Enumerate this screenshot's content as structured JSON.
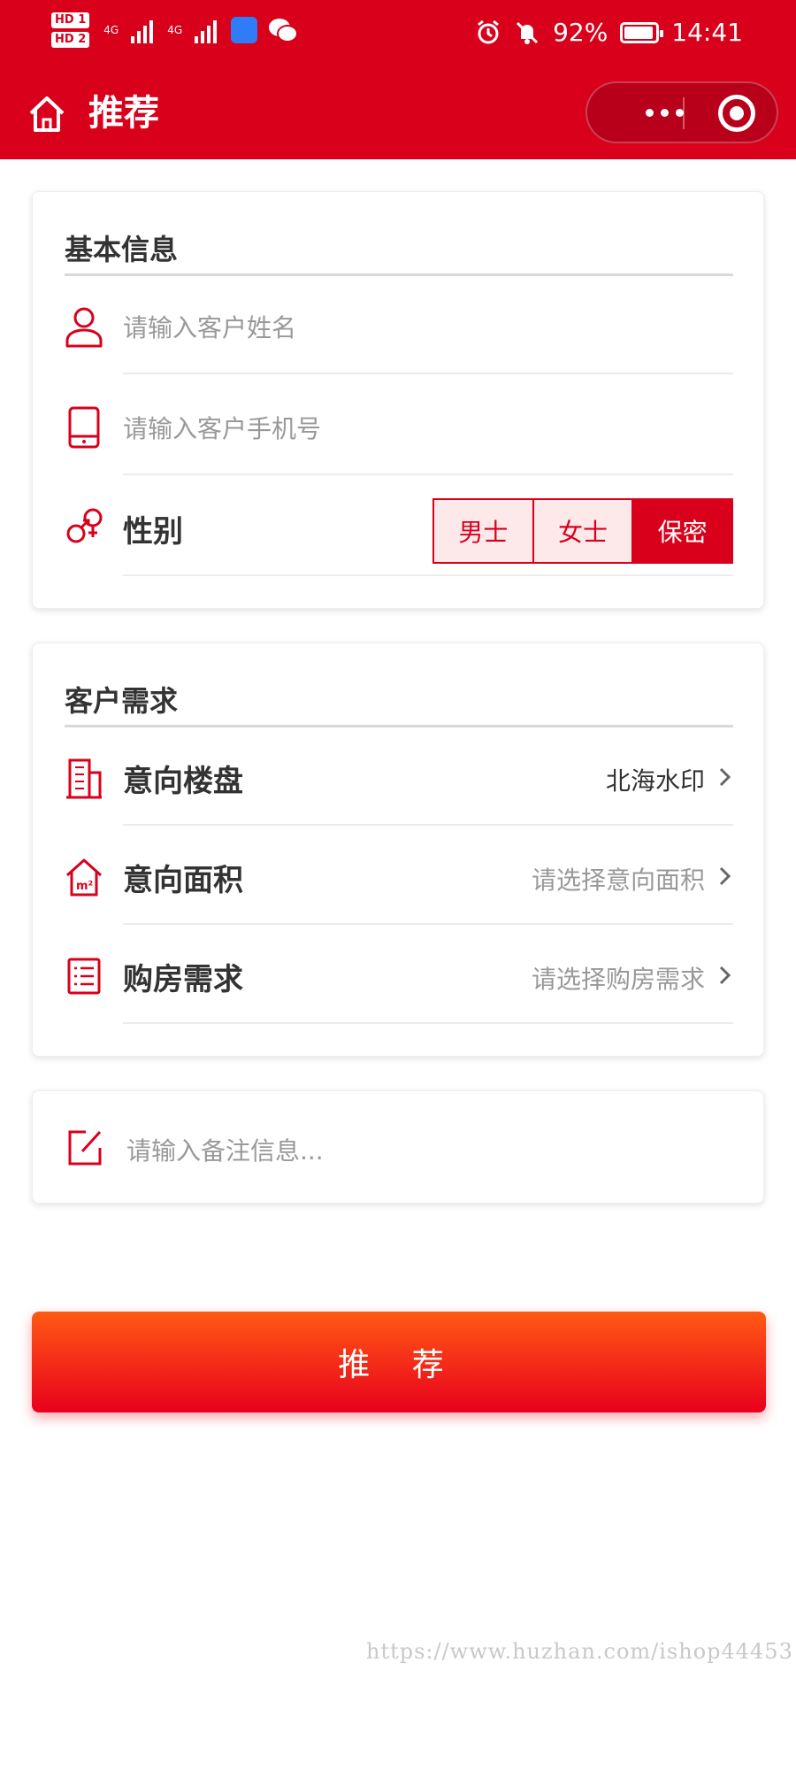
{
  "status_bar": {
    "hd1": "HD 1",
    "hd2": "HD 2",
    "net1": "4G",
    "net2": "4G",
    "battery": "92%",
    "time": "14:41",
    "icons": [
      "alarm-icon",
      "bell-mute-icon",
      "battery-icon",
      "wechat-icon",
      "app-icon"
    ]
  },
  "header": {
    "title": "推荐",
    "home_icon": "home-icon",
    "more_icon": "more-dots-icon",
    "close_icon": "target-circle-icon"
  },
  "basic_info": {
    "title": "基本信息",
    "name_placeholder": "请输入客户姓名",
    "phone_placeholder": "请输入客户手机号",
    "gender_label": "性别",
    "gender_options": [
      "男士",
      "女士",
      "保密"
    ],
    "gender_selected": "保密"
  },
  "customer_needs": {
    "title": "客户需求",
    "rows": [
      {
        "label": "意向楼盘",
        "value": "北海水印"
      },
      {
        "label": "意向面积",
        "value": "请选择意向面积"
      },
      {
        "label": "购房需求",
        "value": "请选择购房需求"
      }
    ]
  },
  "note": {
    "placeholder": "请输入备注信息..."
  },
  "submit": {
    "label": "推 荐"
  },
  "watermark": "https://www.huzhan.com/ishop44453",
  "colors": {
    "brand": "#d9001b",
    "button_top": "#ff5a14",
    "button_bottom": "#e8001c",
    "muted_text": "#999999"
  }
}
